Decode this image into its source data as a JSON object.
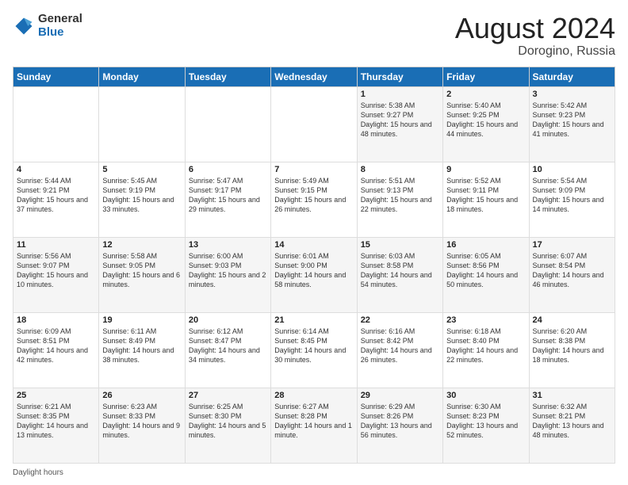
{
  "logo": {
    "general": "General",
    "blue": "Blue"
  },
  "header": {
    "title": "August 2024",
    "subtitle": "Dorogino, Russia"
  },
  "weekdays": [
    "Sunday",
    "Monday",
    "Tuesday",
    "Wednesday",
    "Thursday",
    "Friday",
    "Saturday"
  ],
  "footer": {
    "daylight_label": "Daylight hours"
  },
  "weeks": [
    [
      {
        "day": "",
        "sunrise": "",
        "sunset": "",
        "daylight": ""
      },
      {
        "day": "",
        "sunrise": "",
        "sunset": "",
        "daylight": ""
      },
      {
        "day": "",
        "sunrise": "",
        "sunset": "",
        "daylight": ""
      },
      {
        "day": "",
        "sunrise": "",
        "sunset": "",
        "daylight": ""
      },
      {
        "day": "1",
        "sunrise": "Sunrise: 5:38 AM",
        "sunset": "Sunset: 9:27 PM",
        "daylight": "Daylight: 15 hours and 48 minutes."
      },
      {
        "day": "2",
        "sunrise": "Sunrise: 5:40 AM",
        "sunset": "Sunset: 9:25 PM",
        "daylight": "Daylight: 15 hours and 44 minutes."
      },
      {
        "day": "3",
        "sunrise": "Sunrise: 5:42 AM",
        "sunset": "Sunset: 9:23 PM",
        "daylight": "Daylight: 15 hours and 41 minutes."
      }
    ],
    [
      {
        "day": "4",
        "sunrise": "Sunrise: 5:44 AM",
        "sunset": "Sunset: 9:21 PM",
        "daylight": "Daylight: 15 hours and 37 minutes."
      },
      {
        "day": "5",
        "sunrise": "Sunrise: 5:45 AM",
        "sunset": "Sunset: 9:19 PM",
        "daylight": "Daylight: 15 hours and 33 minutes."
      },
      {
        "day": "6",
        "sunrise": "Sunrise: 5:47 AM",
        "sunset": "Sunset: 9:17 PM",
        "daylight": "Daylight: 15 hours and 29 minutes."
      },
      {
        "day": "7",
        "sunrise": "Sunrise: 5:49 AM",
        "sunset": "Sunset: 9:15 PM",
        "daylight": "Daylight: 15 hours and 26 minutes."
      },
      {
        "day": "8",
        "sunrise": "Sunrise: 5:51 AM",
        "sunset": "Sunset: 9:13 PM",
        "daylight": "Daylight: 15 hours and 22 minutes."
      },
      {
        "day": "9",
        "sunrise": "Sunrise: 5:52 AM",
        "sunset": "Sunset: 9:11 PM",
        "daylight": "Daylight: 15 hours and 18 minutes."
      },
      {
        "day": "10",
        "sunrise": "Sunrise: 5:54 AM",
        "sunset": "Sunset: 9:09 PM",
        "daylight": "Daylight: 15 hours and 14 minutes."
      }
    ],
    [
      {
        "day": "11",
        "sunrise": "Sunrise: 5:56 AM",
        "sunset": "Sunset: 9:07 PM",
        "daylight": "Daylight: 15 hours and 10 minutes."
      },
      {
        "day": "12",
        "sunrise": "Sunrise: 5:58 AM",
        "sunset": "Sunset: 9:05 PM",
        "daylight": "Daylight: 15 hours and 6 minutes."
      },
      {
        "day": "13",
        "sunrise": "Sunrise: 6:00 AM",
        "sunset": "Sunset: 9:03 PM",
        "daylight": "Daylight: 15 hours and 2 minutes."
      },
      {
        "day": "14",
        "sunrise": "Sunrise: 6:01 AM",
        "sunset": "Sunset: 9:00 PM",
        "daylight": "Daylight: 14 hours and 58 minutes."
      },
      {
        "day": "15",
        "sunrise": "Sunrise: 6:03 AM",
        "sunset": "Sunset: 8:58 PM",
        "daylight": "Daylight: 14 hours and 54 minutes."
      },
      {
        "day": "16",
        "sunrise": "Sunrise: 6:05 AM",
        "sunset": "Sunset: 8:56 PM",
        "daylight": "Daylight: 14 hours and 50 minutes."
      },
      {
        "day": "17",
        "sunrise": "Sunrise: 6:07 AM",
        "sunset": "Sunset: 8:54 PM",
        "daylight": "Daylight: 14 hours and 46 minutes."
      }
    ],
    [
      {
        "day": "18",
        "sunrise": "Sunrise: 6:09 AM",
        "sunset": "Sunset: 8:51 PM",
        "daylight": "Daylight: 14 hours and 42 minutes."
      },
      {
        "day": "19",
        "sunrise": "Sunrise: 6:11 AM",
        "sunset": "Sunset: 8:49 PM",
        "daylight": "Daylight: 14 hours and 38 minutes."
      },
      {
        "day": "20",
        "sunrise": "Sunrise: 6:12 AM",
        "sunset": "Sunset: 8:47 PM",
        "daylight": "Daylight: 14 hours and 34 minutes."
      },
      {
        "day": "21",
        "sunrise": "Sunrise: 6:14 AM",
        "sunset": "Sunset: 8:45 PM",
        "daylight": "Daylight: 14 hours and 30 minutes."
      },
      {
        "day": "22",
        "sunrise": "Sunrise: 6:16 AM",
        "sunset": "Sunset: 8:42 PM",
        "daylight": "Daylight: 14 hours and 26 minutes."
      },
      {
        "day": "23",
        "sunrise": "Sunrise: 6:18 AM",
        "sunset": "Sunset: 8:40 PM",
        "daylight": "Daylight: 14 hours and 22 minutes."
      },
      {
        "day": "24",
        "sunrise": "Sunrise: 6:20 AM",
        "sunset": "Sunset: 8:38 PM",
        "daylight": "Daylight: 14 hours and 18 minutes."
      }
    ],
    [
      {
        "day": "25",
        "sunrise": "Sunrise: 6:21 AM",
        "sunset": "Sunset: 8:35 PM",
        "daylight": "Daylight: 14 hours and 13 minutes."
      },
      {
        "day": "26",
        "sunrise": "Sunrise: 6:23 AM",
        "sunset": "Sunset: 8:33 PM",
        "daylight": "Daylight: 14 hours and 9 minutes."
      },
      {
        "day": "27",
        "sunrise": "Sunrise: 6:25 AM",
        "sunset": "Sunset: 8:30 PM",
        "daylight": "Daylight: 14 hours and 5 minutes."
      },
      {
        "day": "28",
        "sunrise": "Sunrise: 6:27 AM",
        "sunset": "Sunset: 8:28 PM",
        "daylight": "Daylight: 14 hours and 1 minute."
      },
      {
        "day": "29",
        "sunrise": "Sunrise: 6:29 AM",
        "sunset": "Sunset: 8:26 PM",
        "daylight": "Daylight: 13 hours and 56 minutes."
      },
      {
        "day": "30",
        "sunrise": "Sunrise: 6:30 AM",
        "sunset": "Sunset: 8:23 PM",
        "daylight": "Daylight: 13 hours and 52 minutes."
      },
      {
        "day": "31",
        "sunrise": "Sunrise: 6:32 AM",
        "sunset": "Sunset: 8:21 PM",
        "daylight": "Daylight: 13 hours and 48 minutes."
      }
    ]
  ]
}
